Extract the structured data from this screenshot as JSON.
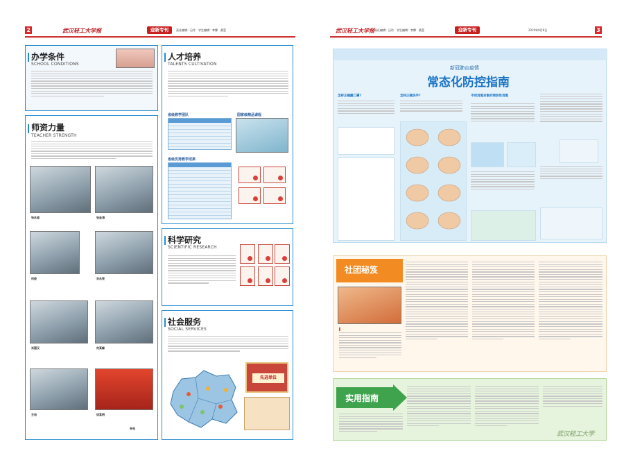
{
  "header": {
    "left_page_num": "2",
    "right_page_num": "3",
    "masthead_left": "武汉轻工大学报",
    "masthead_right": "武汉轻工大学报",
    "section_tag_left": "迎新专刊",
    "section_tag_right": "迎新专刊",
    "editor_left": "责任编辑：吕玲　学生编辑：李霖　黄莹",
    "editor_right": "责任编辑：吕玲　学生编辑：李霖　黄莹",
    "date_right": "2020年9月8日"
  },
  "sections": {
    "school": {
      "title": "办学条件",
      "subtitle": "SCHOOL CONDITIONS"
    },
    "teacher": {
      "title": "师资力量",
      "subtitle": "TEACHER STRENGTH",
      "people": [
        "张永道",
        "张金涛",
        "何俊",
        "刘永亮",
        "肖国汉",
        "何某峰",
        "王电",
        "徐某明",
        "朱电"
      ]
    },
    "talent": {
      "title": "人才培养",
      "subtitle": "TALENTS CULTIVATION",
      "table1_label": "省级教学团队",
      "table2_label": "国家级精品课程",
      "table3_label": "省级优秀教学成果"
    },
    "science": {
      "title": "科学研究",
      "subtitle": "SCIENTIFIC RESEARCH"
    },
    "social": {
      "title": "社会服务",
      "subtitle": "SOCIAL SERVICES",
      "award": "先进单位"
    }
  },
  "covid": {
    "kicker": "新冠肺炎疫情",
    "title": "常态化防控指南",
    "sub_cough": "怎样正确戴口罩?",
    "sub_hand": "怎样正确洗手?",
    "sub_disinfect": "不同消毒对象的预防性消毒"
  },
  "club": {
    "title": "社团秘笈"
  },
  "guide": {
    "title": "实用指南",
    "footer_logo": "武汉轻工大学"
  },
  "colors": {
    "accent_red": "#c81e1e",
    "panel_blue": "#2a8ccf",
    "covid_blue": "#1b74c5",
    "club_orange": "#f28c22",
    "guide_green": "#3fa34d"
  }
}
